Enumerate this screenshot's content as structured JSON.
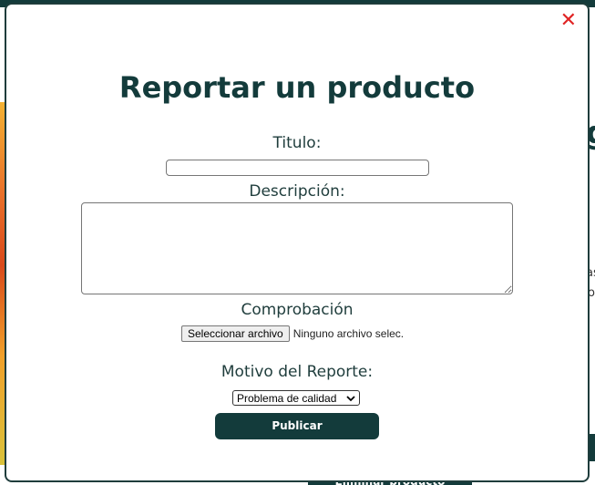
{
  "modal": {
    "close_icon": "✕",
    "title": "Reportar un producto",
    "titulo_label": "Titulo:",
    "titulo_value": "",
    "descripcion_label": "Descripción:",
    "descripcion_value": "",
    "comprobacion_label": "Comprobación",
    "file_button_label": "Seleccionar archivo",
    "file_status": "Ninguno archivo selec.",
    "motivo_label": "Motivo del Reporte:",
    "motivo_selected": "Problema de calidad",
    "publish_label": "Publicar"
  },
  "background": {
    "bottom_button_label": "Eliminar producto",
    "right_fragment_1": "as",
    "right_fragment_2": "o",
    "big_char": "g"
  },
  "colors": {
    "accent": "#133b3b",
    "close": "#e02424"
  }
}
